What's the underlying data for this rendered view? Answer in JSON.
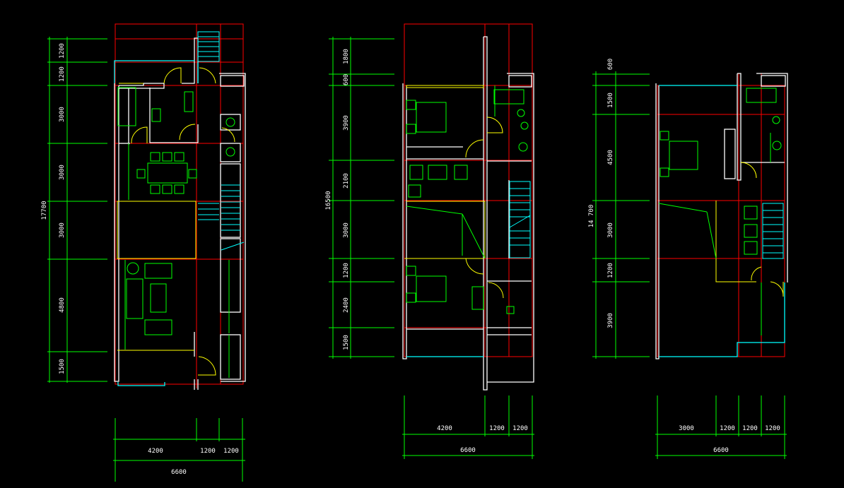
{
  "colors": {
    "background": "#000000",
    "dimension": "#00ff00",
    "axis": "#ff0000",
    "wall": "#ffffff",
    "window": "#00ffff",
    "door": "#ffff00",
    "furniture": "#00ff00"
  },
  "plans": [
    {
      "total_vertical": "17700",
      "vertical_dims": [
        "1200",
        "1200",
        "3000",
        "3000",
        "3000",
        "4800",
        "1500"
      ],
      "horizontal_dims": [
        "4200",
        "1200",
        "1200"
      ],
      "total_horizontal": "6600"
    },
    {
      "total_vertical": "16500",
      "vertical_dims": [
        "1800",
        "600",
        "3900",
        "2100",
        "3000",
        "1200",
        "2400",
        "1500"
      ],
      "horizontal_dims": [
        "4200",
        "1200",
        "1200"
      ],
      "total_horizontal": "6600"
    },
    {
      "total_vertical": "14 700",
      "vertical_dims": [
        "600",
        "1500",
        "4500",
        "3000",
        "1200",
        "3900"
      ],
      "horizontal_dims": [
        "3000",
        "1200",
        "1200",
        "1200"
      ],
      "total_horizontal": "6600"
    }
  ]
}
